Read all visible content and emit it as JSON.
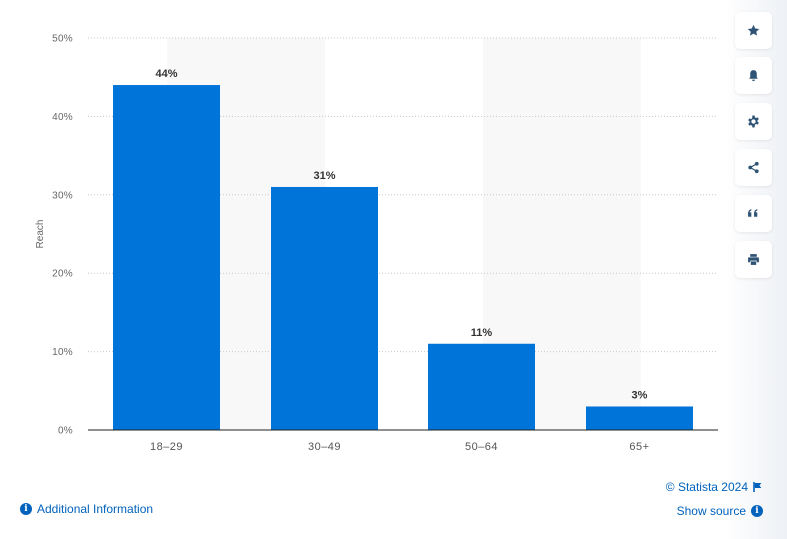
{
  "chart_data": {
    "type": "bar",
    "title": "",
    "xlabel": "",
    "ylabel": "Reach",
    "categories": [
      "18-29",
      "30-49",
      "50-64",
      "65+"
    ],
    "values": [
      44,
      31,
      11,
      3
    ],
    "value_labels": [
      "44%",
      "31%",
      "11%",
      "3%"
    ],
    "ylim": [
      0,
      50
    ],
    "yticks": [
      0,
      10,
      20,
      30,
      40,
      50
    ],
    "ytick_labels": [
      "0%",
      "10%",
      "20%",
      "30%",
      "40%",
      "50%"
    ],
    "grid": true,
    "bar_color": "#0074d9",
    "alternate_band_color": "#f8f8f8",
    "legend": "none"
  },
  "toolbar": {
    "buttons": [
      {
        "icon": "star-icon",
        "label": "Favorite"
      },
      {
        "icon": "bell-icon",
        "label": "Notification"
      },
      {
        "icon": "gear-icon",
        "label": "Settings"
      },
      {
        "icon": "share-icon",
        "label": "Share"
      },
      {
        "icon": "quote-icon",
        "label": "Cite"
      },
      {
        "icon": "print-icon",
        "label": "Print"
      }
    ]
  },
  "footer": {
    "additional_info": "Additional Information",
    "copyright": "© Statista 2024",
    "show_source": "Show source"
  },
  "colors": {
    "link": "#0062bc",
    "icon": "#2f5374"
  }
}
